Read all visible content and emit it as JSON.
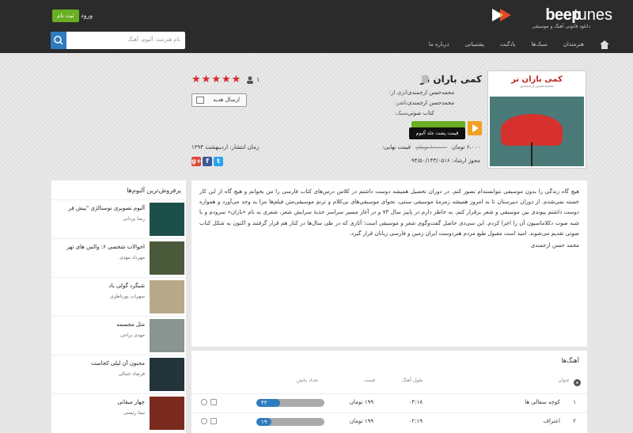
{
  "header": {
    "brand_bold": "beep",
    "brand_light": "tunes",
    "tagline": "دانلود قانونی آهنگ و موسیقی",
    "register_label": "ثبت نام",
    "login_label": "ورود",
    "search_placeholder": "نام هنرمند، آلبوم، آهنگ",
    "nav": [
      "هنرمندان",
      "سبک‌ها",
      "یادگیت",
      "پشتیبانی",
      "درباره ما"
    ]
  },
  "album": {
    "title": "کمی باران تر",
    "cover_title": "کمی باران تر",
    "cover_subtitle": "محمدحسن ارجمندی",
    "rating_count": "۱",
    "meta": [
      {
        "key": "اثری از:",
        "value": "محمدحسن ارجمندی"
      },
      {
        "key": "ناشر:",
        "value": "محمدحسن ارجمندی"
      },
      {
        "key": "سبک:",
        "value": "کتاب صوتی"
      }
    ],
    "gift_label": "ارسال هدیه",
    "tooltip": "قیمت پشت جلد آلبوم",
    "price_label": "قیمت نهایی:",
    "price_old": "۱۰،۰۰۰ تومان",
    "price_new": "۶،۰۰۰ تومان",
    "date": "زمان انتشار: اردیبهشت ۱۳۹۴",
    "license": "مجوز ارشاد: ۹۴/۵۰/۱۴۳/۰۵۱۶",
    "social": [
      "t",
      "f",
      "g+"
    ]
  },
  "description": {
    "text": "هیچ گاه زندگی را بدون موسیقی نتوانسته‌ام تصور کنم. در دوران تحصیل همیشه دوست داشتم در کلاس درس‌های کتاب فارسی را من بخوانم و هیچ گاه از این کار خسته نمی‌شدم. از دوران دبیرستان تا به امروز همیشه زمزمهٔ موسیقی سنتی، نجوای موسیقی‌های بی‌کلام و ترنم موسیقی‌متن فیلم‌ها مرا به وجد می‌آورد و همواره دوست داشتم پیوندی بین موسیقی و شعر برقرار کنم. به خاطر دارم در پاییز سال ۷۳ و در آغاز مسیر سراسر جذبهٔ سرایش شعر، شعری به نام «باران» سرودم و با شبه صوت دکلاماسیون آن را اجرا کردم. این سی‌دی حاصل گفت‌وگوی شعر و موسیقی است؛ آثاری که در طی سال‌ها در کنار هم قرار گرفتند و اکنون به شکل کتاب صوتی تقدیم می‌شوند. امید است مقبول طبع مردم هنردوست ایران زمین و فارسی زبانان قرار گیرد.",
    "signature": "محمد حسن ارجمندی"
  },
  "tracks": {
    "title": "آهنگ‌ها",
    "columns": {
      "name": "عنوان",
      "duration": "طول آهنگ",
      "price": "قیمت",
      "plays": "تعداد پخش"
    },
    "rows": [
      {
        "index": "۱",
        "name": "کوچه سفالی ها",
        "duration": "۰۴:۱۸",
        "price": "۱۹۹ تومان",
        "plays": "۴۳",
        "plays_fraction": 0.35
      },
      {
        "index": "۲",
        "name": "اعتراف",
        "duration": "۰۲:۱۹",
        "price": "۱۹۹ تومان",
        "plays": "۱۹",
        "plays_fraction": 0.22
      }
    ]
  },
  "sidebar": {
    "title": "پرفروش‌ترین آلبوم‌ها",
    "items": [
      {
        "title": "آلبوم تصویری نوستالژی \"پیش فر",
        "artist": "رضا یزدانی"
      },
      {
        "title": "احوالات شخصی ۶: والس های تهر",
        "artist": "مهرداد مهدی"
      },
      {
        "title": "شیگرد گولی باد",
        "artist": "سهراب پورناظری"
      },
      {
        "title": "مثل مجسمه",
        "artist": "مهدی یراحی"
      },
      {
        "title": "مجنون آن لیلی کجاست",
        "artist": "فرشاد جمالی"
      },
      {
        "title": "چهار میقاتی",
        "artist": "نیما رئیسی"
      }
    ]
  },
  "colors": {
    "accent": "#2e7bbf",
    "brand_red": "#d8262d",
    "green": "#6aae22",
    "orange": "#f0a024"
  }
}
